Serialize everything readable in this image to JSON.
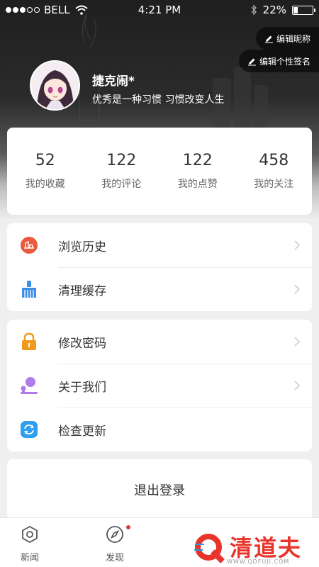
{
  "status_bar": {
    "carrier": "BELL",
    "time": "4:21 PM",
    "battery": "22%",
    "battery_level": 0.22
  },
  "header": {
    "edit_nickname": "编辑昵称",
    "edit_signature": "编辑个性签名",
    "nickname": "捷克闹*",
    "signature": "优秀是一种习惯 习惯改变人生"
  },
  "stats": [
    {
      "value": "52",
      "label": "我的收藏"
    },
    {
      "value": "122",
      "label": "我的评论"
    },
    {
      "value": "122",
      "label": "我的点赞"
    },
    {
      "value": "458",
      "label": "我的关注"
    }
  ],
  "menu_group1": [
    {
      "label": "浏览历史",
      "icon": "history-icon"
    },
    {
      "label": "清理缓存",
      "icon": "broom-icon"
    }
  ],
  "menu_group2": [
    {
      "label": "修改密码",
      "icon": "lock-icon"
    },
    {
      "label": "关于我们",
      "icon": "about-icon"
    },
    {
      "label": "检查更新",
      "icon": "refresh-icon"
    }
  ],
  "logout_label": "退出登录",
  "tabs": [
    {
      "label": "新闻",
      "icon": "hexagon-icon"
    },
    {
      "label": "发现",
      "icon": "compass-icon"
    }
  ],
  "watermark": {
    "text": "清道夫",
    "url": "WWW.QDFUJI.COM"
  },
  "colors": {
    "history": "#ea5a3c",
    "broom": "#3d8ee6",
    "lock": "#f29a1e",
    "about": "#b07be8",
    "refresh": "#2e9ff0",
    "badge": "#e03b3b"
  }
}
